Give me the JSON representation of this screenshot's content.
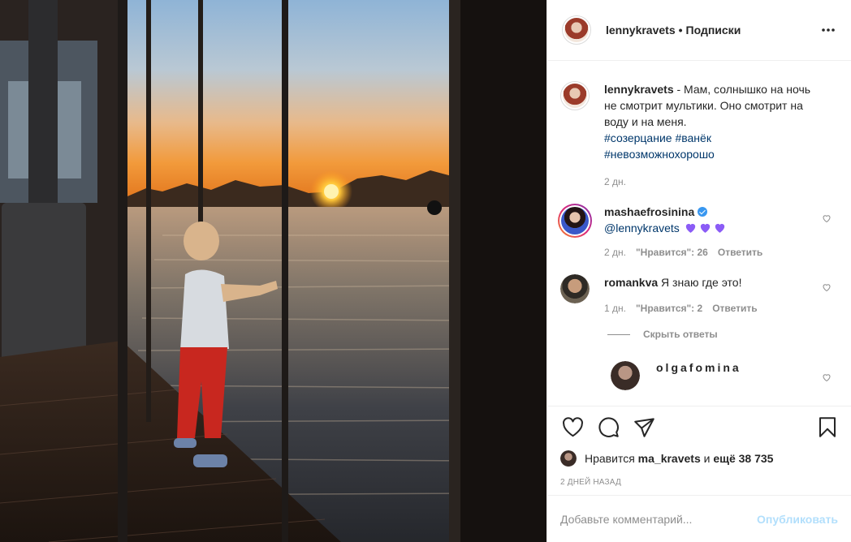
{
  "post": {
    "author": "lennykravets",
    "follow_label": "Подписки",
    "separator": "•",
    "caption_text": " - Мам, солнышко на ночь не смотрит мультики. Оно смотрит на воду и на меня.",
    "hashtags": [
      "#созерцание",
      "#ванёк",
      "#невозможнохорошо"
    ],
    "caption_time": "2 дн."
  },
  "comments": [
    {
      "username": "mashaefrosinina",
      "verified": true,
      "mention": "@lennykravets",
      "text": "",
      "time": "2 дн.",
      "likes": "\"Нравится\": 26",
      "reply": "Ответить"
    },
    {
      "username": "romankva",
      "verified": false,
      "text": "Я знаю где это!",
      "time": "1 дн.",
      "likes": "\"Нравится\": 2",
      "reply": "Ответить"
    }
  ],
  "hide_replies_label": "Скрыть ответы",
  "partial_reply_username": "olgafomina",
  "likes_bar": {
    "prefix": "Нравится",
    "user": "ma_kravets",
    "conj": "и",
    "rest": "ещё 38 735"
  },
  "post_date": "2 ДНЕЙ НАЗАД",
  "add_comment": {
    "placeholder": "Добавьте комментарий...",
    "publish_label": "Опубликовать"
  },
  "colors": {
    "link": "#00376b",
    "muted": "#8e8e8e",
    "publish_disabled": "#b2dffc",
    "verified": "#3897f0",
    "emoji_heart": "#8b5cf6"
  },
  "icons": [
    "more-icon",
    "heart-icon",
    "comment-icon",
    "share-icon",
    "bookmark-icon",
    "verified-icon",
    "purple-heart-icon"
  ]
}
